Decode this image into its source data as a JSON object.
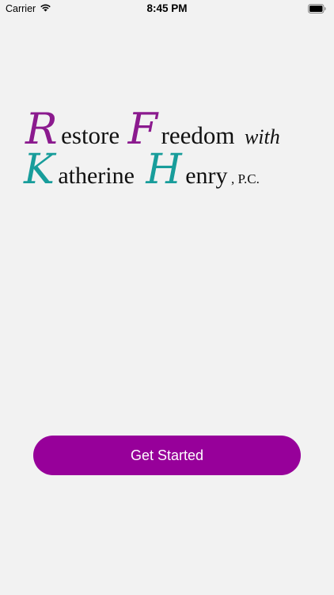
{
  "status_bar": {
    "carrier": "Carrier",
    "time": "8:45 PM",
    "wifi_icon": "wifi-icon",
    "battery_icon": "battery-icon"
  },
  "logo": {
    "line1": {
      "initial_1": "R",
      "word_1_rest": "estore",
      "initial_2": "F",
      "word_2_rest": "reedom",
      "suffix": "with"
    },
    "line2": {
      "initial_1": "K",
      "word_1_rest": "atherine",
      "initial_2": "H",
      "word_2_rest": "enry",
      "suffix": ", P.C."
    },
    "colors": {
      "purple": "#8b1a8e",
      "teal": "#189d9b",
      "black": "#111111"
    }
  },
  "actions": {
    "get_started_label": "Get Started",
    "button_color": "#97009a"
  }
}
